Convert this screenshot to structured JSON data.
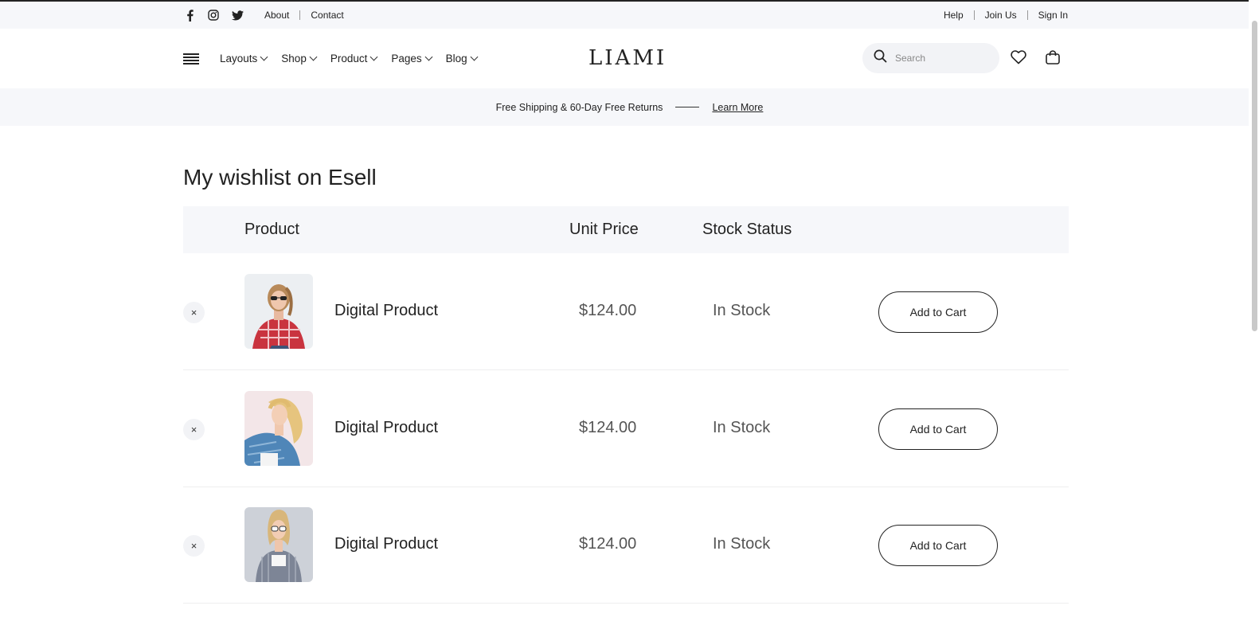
{
  "topbar": {
    "social_icons": [
      "facebook-icon",
      "instagram-icon",
      "twitter-icon"
    ],
    "left_links": [
      "About",
      "Contact"
    ],
    "right_links": [
      "Help",
      "Join Us",
      "Sign In"
    ]
  },
  "header": {
    "nav": [
      "Layouts",
      "Shop",
      "Product",
      "Pages",
      "Blog"
    ],
    "logo": "LIAMI",
    "search_placeholder": "Search",
    "icons": [
      "menu-icon",
      "search-icon",
      "heart-icon",
      "shopping-bag-icon"
    ]
  },
  "promo": {
    "text": "Free Shipping & 60-Day Free Returns",
    "link": "Learn More"
  },
  "page_title": "My wishlist on Esell",
  "table": {
    "headers": {
      "product": "Product",
      "unit_price": "Unit Price",
      "stock_status": "Stock Status"
    },
    "rows": [
      {
        "name": "Digital Product",
        "price": "$124.00",
        "stock": "In Stock",
        "action": "Add to Cart",
        "remove": "×"
      },
      {
        "name": "Digital Product",
        "price": "$124.00",
        "stock": "In Stock",
        "action": "Add to Cart",
        "remove": "×"
      },
      {
        "name": "Digital Product",
        "price": "$124.00",
        "stock": "In Stock",
        "action": "Add to Cart",
        "remove": "×"
      }
    ]
  },
  "colors": {
    "topbar_bg": "#f6f7fa",
    "text": "#222222",
    "muted": "#555555"
  }
}
